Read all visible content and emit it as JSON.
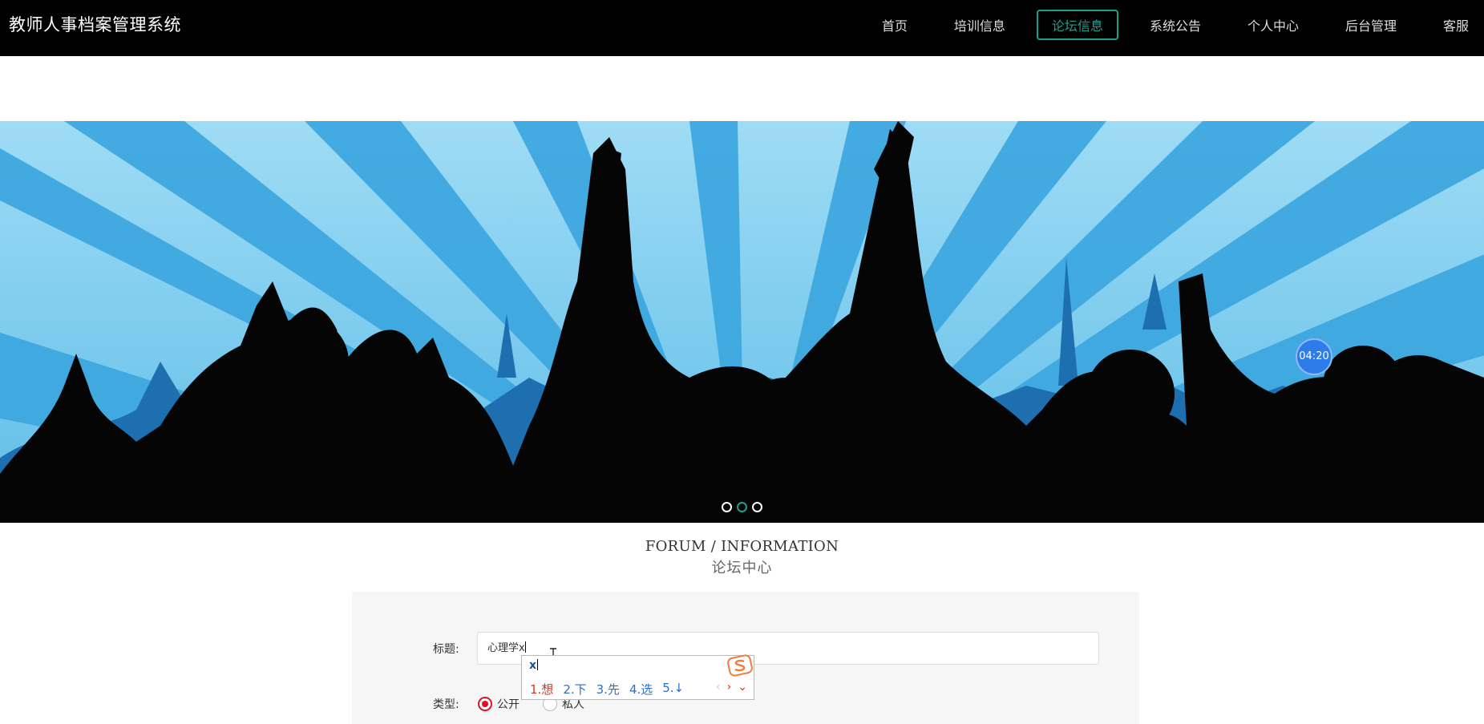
{
  "site": {
    "title": "教师人事档案管理系统"
  },
  "nav": [
    {
      "label": "首页",
      "active": false
    },
    {
      "label": "培训信息",
      "active": false
    },
    {
      "label": "论坛信息",
      "active": true
    },
    {
      "label": "系统公告",
      "active": false
    },
    {
      "label": "个人中心",
      "active": false
    },
    {
      "label": "后台管理",
      "active": false
    },
    {
      "label": "客服",
      "active": false
    }
  ],
  "colors": {
    "accent": "#1aa08e",
    "nav_bg": "#000000",
    "radio_selected": "#dd1122"
  },
  "banner": {
    "slide_count": 3,
    "active_slide": 2,
    "timer": "04:20"
  },
  "section": {
    "title_en": "FORUM / INFORMATION",
    "title_cn": "论坛中心"
  },
  "form": {
    "title_label": "标题:",
    "title_value": "心理学x",
    "type_label": "类型:",
    "type_options": [
      {
        "label": "公开",
        "checked": true
      },
      {
        "label": "私人",
        "checked": false
      }
    ]
  },
  "ime": {
    "input": "x",
    "candidates": [
      "1.想",
      "2.下",
      "3.先",
      "4.选",
      "5.↓"
    ],
    "prev_icon": "chevron-left-icon",
    "next_icon": "chevron-right-icon",
    "expand_icon": "chevron-down-icon",
    "logo_icon": "sogou-logo-icon"
  }
}
